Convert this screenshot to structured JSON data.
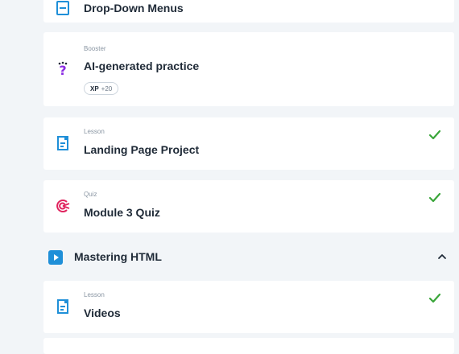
{
  "items": [
    {
      "kind": "",
      "title": "Drop-Down Menus",
      "icon": "lesson-doc-icon",
      "completed": false
    },
    {
      "kind": "Booster",
      "title": "AI-generated practice",
      "icon": "question-sparkle-icon",
      "completed": false,
      "xp_label": "XP",
      "xp_amount": "+20"
    },
    {
      "kind": "Lesson",
      "title": "Landing Page Project",
      "icon": "lesson-doc-icon",
      "completed": true
    },
    {
      "kind": "Quiz",
      "title": "Module 3 Quiz",
      "icon": "quiz-target-icon",
      "completed": true
    },
    {
      "kind": "Lesson",
      "title": "Videos",
      "icon": "lesson-doc-icon",
      "completed": true
    }
  ],
  "section": {
    "title": "Mastering HTML",
    "icon": "play-icon",
    "expanded": true
  },
  "colors": {
    "background": "#f2f5f8",
    "lesson_icon": "#1f8fd8",
    "quiz_icon": "#e0245e",
    "check": "#3aa63a",
    "section_icon": "#1f8fd8"
  }
}
